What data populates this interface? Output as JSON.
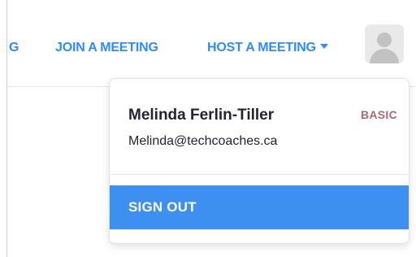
{
  "header": {
    "nav_partial_label": "G",
    "join_meeting_label": "JOIN A MEETING",
    "host_meeting_label": "HOST A MEETING",
    "avatar_icon": "user-avatar-icon",
    "accent_color": "#2d8cff"
  },
  "dropdown": {
    "user_name": "Melinda Ferlin-Tiller",
    "plan_badge": "BASIC",
    "email": "Melinda@techcoaches.ca",
    "sign_out_label": "SIGN OUT",
    "highlight_color": "#3d8ff0"
  }
}
